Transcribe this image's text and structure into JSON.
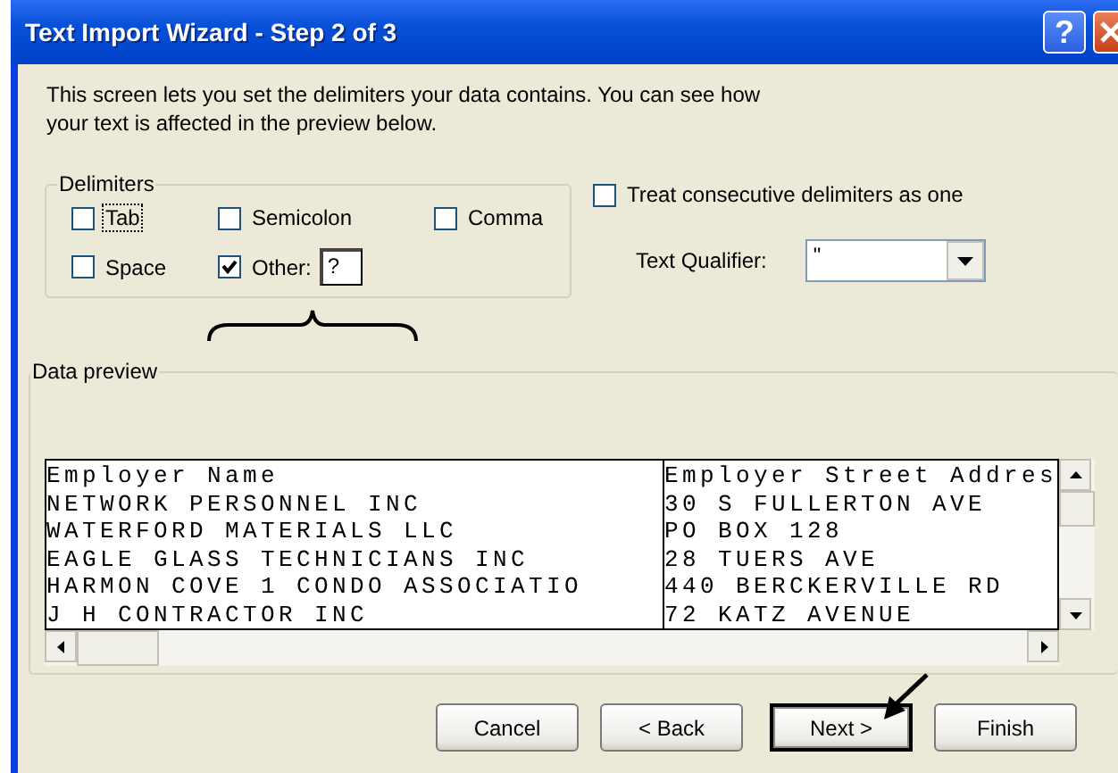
{
  "window": {
    "title": "Text Import Wizard - Step 2 of 3",
    "help_button": "?"
  },
  "intro": "This screen lets you set the delimiters your data contains.  You can see how your text is affected in the preview below.",
  "delimiters": {
    "label": "Delimiters",
    "options": [
      {
        "label": "Tab",
        "checked": false,
        "focused": true
      },
      {
        "label": "Semicolon",
        "checked": false,
        "focused": false
      },
      {
        "label": "Comma",
        "checked": false,
        "focused": false
      },
      {
        "label": "Space",
        "checked": false,
        "focused": false
      },
      {
        "label": "Other:",
        "checked": true,
        "focused": false,
        "value": "?"
      }
    ]
  },
  "consecutive": {
    "label": "Treat consecutive delimiters as one",
    "checked": false
  },
  "text_qualifier": {
    "label": "Text Qualifier:",
    "value": "\""
  },
  "preview": {
    "label": "Data preview",
    "columns": [
      {
        "lines": [
          "Employer Name",
          "NETWORK PERSONNEL INC",
          "WATERFORD MATERIALS LLC",
          "EAGLE GLASS TECHNICIANS INC",
          "HARMON COVE 1 CONDO ASSOCIATIO",
          "J H CONTRACTOR INC"
        ]
      },
      {
        "lines": [
          "Employer Street Addres",
          "30 S FULLERTON AVE",
          "PO BOX 128",
          "28 TUERS AVE",
          "440 BERCKERVILLE RD",
          "72 KATZ AVENUE"
        ]
      }
    ]
  },
  "buttons": [
    {
      "label": "Cancel",
      "default": false
    },
    {
      "label": "< Back",
      "default": false
    },
    {
      "label": "Next >",
      "default": true
    },
    {
      "label": "Finish",
      "default": false
    }
  ]
}
